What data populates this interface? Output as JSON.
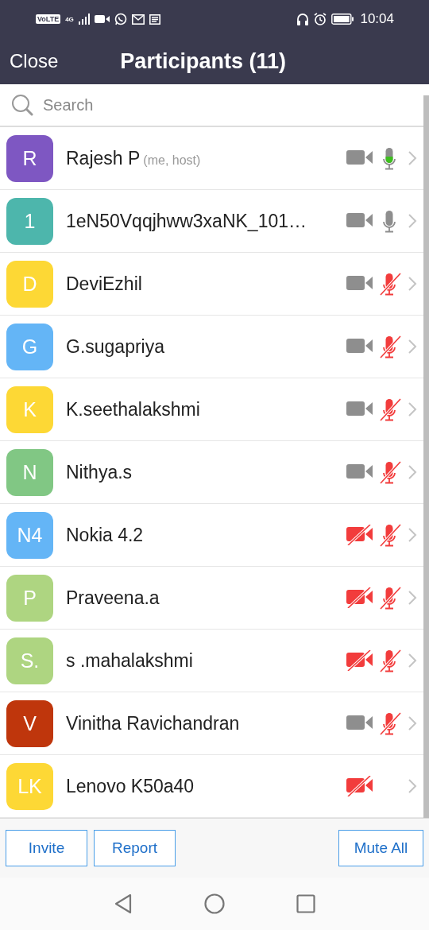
{
  "status_bar": {
    "network_label": "VoLTE",
    "signal_label": "4G",
    "time": "10:04"
  },
  "header": {
    "close": "Close",
    "title": "Participants (11)"
  },
  "search": {
    "placeholder": "Search"
  },
  "participants": [
    {
      "initials": "R",
      "color": "#7e57c2",
      "name": "Rajesh P",
      "note": "(me, host)",
      "video_off": false,
      "mic": {
        "muted": false,
        "speaking": true
      }
    },
    {
      "initials": "1",
      "color": "#4db6ac",
      "name": "1eN50Vqqjhww3xaNK_101…",
      "video_off": false,
      "mic": {
        "muted": false,
        "speaking": false
      }
    },
    {
      "initials": "D",
      "color": "#fdd835",
      "name": "DeviEzhil",
      "video_off": false,
      "mic": {
        "muted": true,
        "speaking": false
      }
    },
    {
      "initials": "G",
      "color": "#64b5f6",
      "name": "G.sugapriya",
      "video_off": false,
      "mic": {
        "muted": true,
        "speaking": false
      }
    },
    {
      "initials": "K",
      "color": "#fdd835",
      "name": "K.seethalakshmi",
      "video_off": false,
      "mic": {
        "muted": true,
        "speaking": false
      }
    },
    {
      "initials": "N",
      "color": "#81c784",
      "name": "Nithya.s",
      "video_off": false,
      "mic": {
        "muted": true,
        "speaking": false
      }
    },
    {
      "initials": "N4",
      "color": "#64b5f6",
      "name": "Nokia 4.2",
      "video_off": true,
      "mic": {
        "muted": true,
        "speaking": false
      }
    },
    {
      "initials": "P",
      "color": "#aed581",
      "name": "Praveena.a",
      "video_off": true,
      "mic": {
        "muted": true,
        "speaking": false
      }
    },
    {
      "initials": "S.",
      "color": "#aed581",
      "name": "s .mahalakshmi",
      "video_off": true,
      "mic": {
        "muted": true,
        "speaking": false
      }
    },
    {
      "initials": "V",
      "color": "#bf360c",
      "name": "Vinitha Ravichandran",
      "video_off": false,
      "mic": {
        "muted": true,
        "speaking": false
      }
    },
    {
      "initials": "LK",
      "color": "#fdd835",
      "name": "Lenovo K50a40",
      "video_off": true
    }
  ],
  "buttons": {
    "left": [
      "Invite",
      "Report"
    ],
    "right": [
      "Mute All"
    ]
  }
}
